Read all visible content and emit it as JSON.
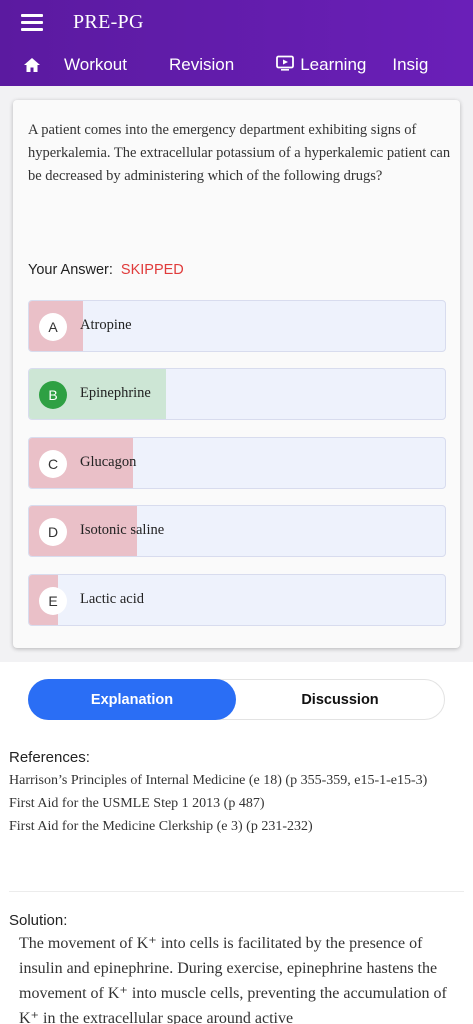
{
  "app": {
    "title": "PRE-PG"
  },
  "nav": {
    "tabs": [
      {
        "label": "Workout"
      },
      {
        "label": "Revision"
      },
      {
        "label": "Learning"
      },
      {
        "label": "Insig"
      }
    ]
  },
  "question": {
    "text": "A patient comes into the emergency department exhibiting signs of hyperkalemia. The extracellular potassium of a hyperkalemic patient can be decreased by administering which of the following drugs?",
    "your_answer_label": "Your Answer:",
    "your_answer_value": "SKIPPED"
  },
  "options": [
    {
      "letter": "A",
      "text": "Atropine",
      "correct": false,
      "percent": 13
    },
    {
      "letter": "B",
      "text": "Epinephrine",
      "correct": true,
      "percent": 33
    },
    {
      "letter": "C",
      "text": "Glucagon",
      "correct": false,
      "percent": 25
    },
    {
      "letter": "D",
      "text": "Isotonic saline",
      "correct": false,
      "percent": 26
    },
    {
      "letter": "E",
      "text": "Lactic acid",
      "correct": false,
      "percent": 7
    }
  ],
  "colors": {
    "wrong_fill": "#eac0c8",
    "correct_fill": "#cde6d5",
    "accent": "#2a6ef5",
    "appbar": "#5b1aa0"
  },
  "tabs": {
    "explanation": "Explanation",
    "discussion": "Discussion"
  },
  "references": {
    "heading": "References:",
    "items": [
      "Harrison’s Principles of Internal Medicine (e 18) (p 355-359, e15-1-e15-3)",
      "First Aid for the USMLE Step 1 2013 (p 487)",
      "First Aid for the Medicine Clerkship (e 3) (p 231-232)"
    ]
  },
  "solution": {
    "heading": "Solution:",
    "text": "The movement of K⁺ into cells is facilitated by the presence of insulin and epinephrine. During exercise, epinephrine hastens the movement of K⁺ into muscle cells, preventing the accumulation of K⁺ in the extracellular space around active"
  }
}
